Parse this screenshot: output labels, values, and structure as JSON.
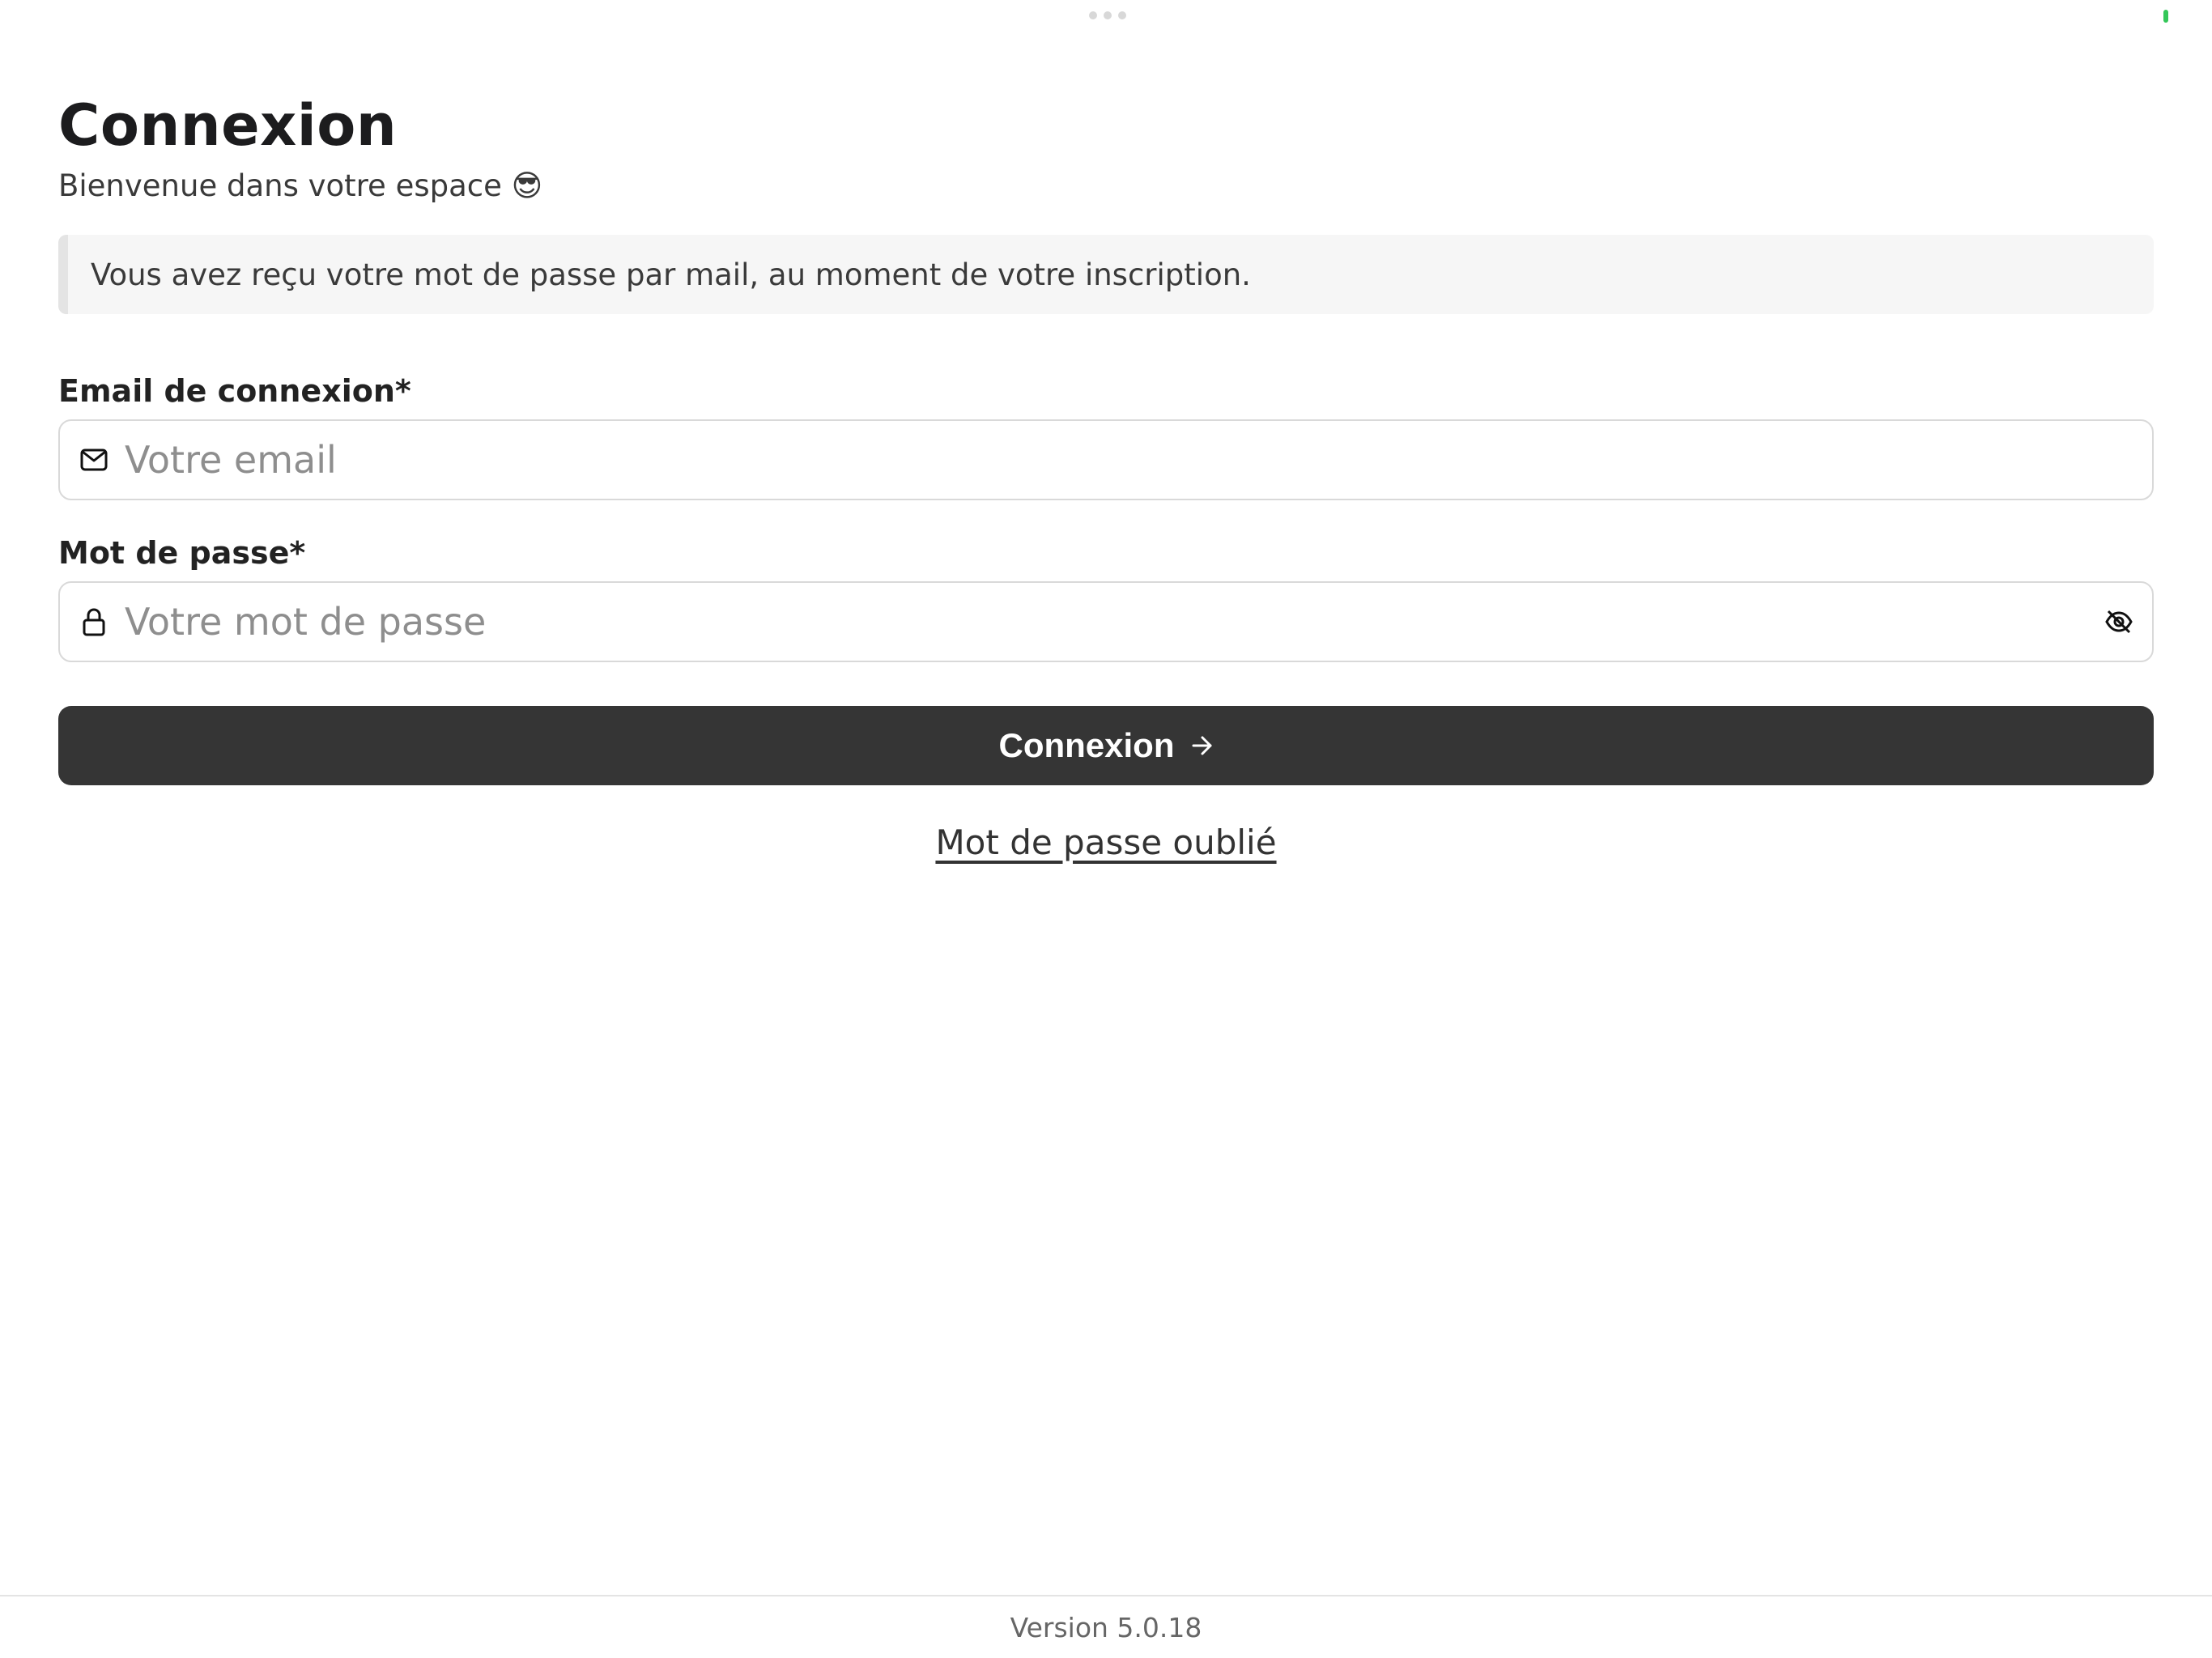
{
  "login": {
    "title": "Connexion",
    "subtitle": "Bienvenue dans votre espace 😎",
    "info": "Vous avez reçu votre mot de passe par mail, au moment de votre inscription.",
    "email_label": "Email de connexion*",
    "email_placeholder": "Votre email",
    "password_label": "Mot de passe*",
    "password_placeholder": "Votre mot de passe",
    "submit_label": "Connexion",
    "forgot_label": "Mot de passe oublié"
  },
  "icons": {
    "email": "mail-icon",
    "password": "lock-icon",
    "toggle": "eye-off-icon",
    "submit": "arrow-right-icon"
  },
  "colors": {
    "button_bg": "#353535",
    "info_bg": "#f6f6f6",
    "status_indicator": "#34c759"
  },
  "footer": {
    "version": "Version 5.0.18"
  }
}
